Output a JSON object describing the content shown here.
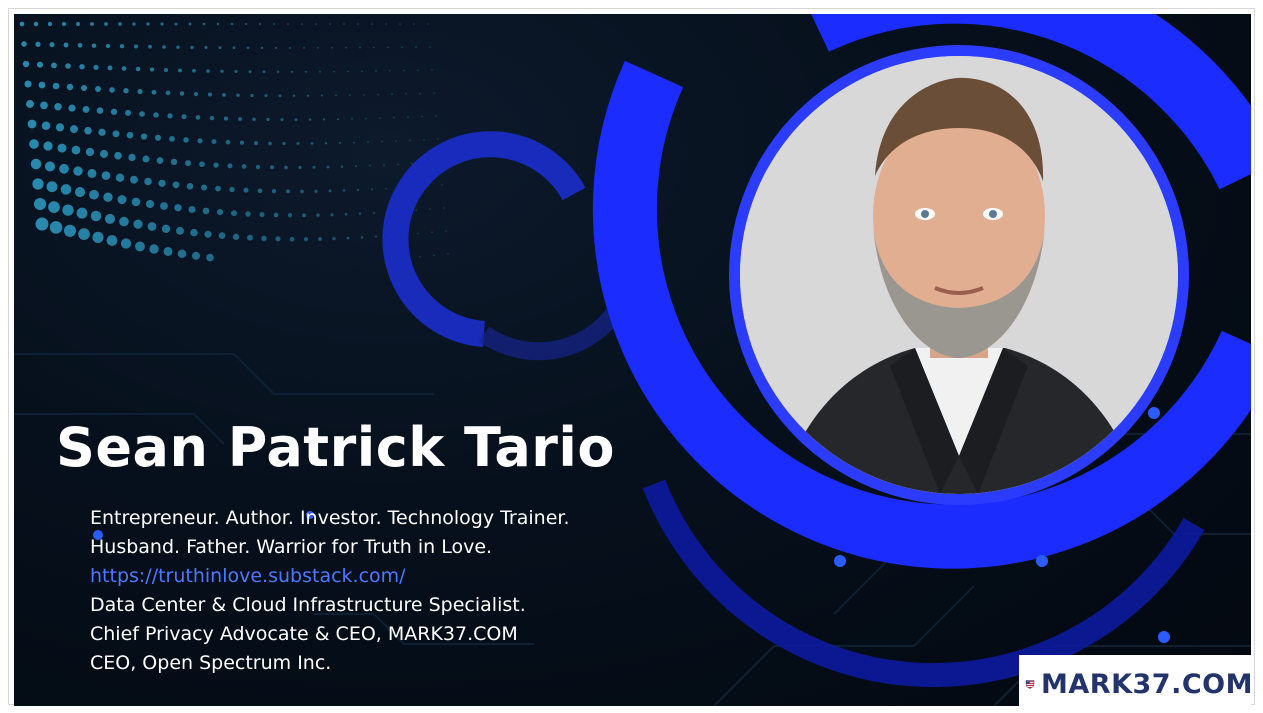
{
  "slide": {
    "name": "Sean Patrick Tario",
    "bio_lines": [
      "Entrepreneur. Author. Investor. Technology Trainer.",
      "Husband. Father. Warrior for Truth in Love.",
      "https://truthinlove.substack.com/",
      "Data Center & Cloud Infrastructure Specialist.",
      "Chief Privacy Advocate & CEO, MARK37.COM",
      "CEO, Open Spectrum Inc."
    ],
    "link_url": "https://truthinlove.substack.com/",
    "logo_text": "MARK37.COM",
    "colors": {
      "accent_blue": "#1a2cff",
      "link": "#4e78ff",
      "logo_text": "#22346b",
      "background": "#06101c"
    }
  }
}
